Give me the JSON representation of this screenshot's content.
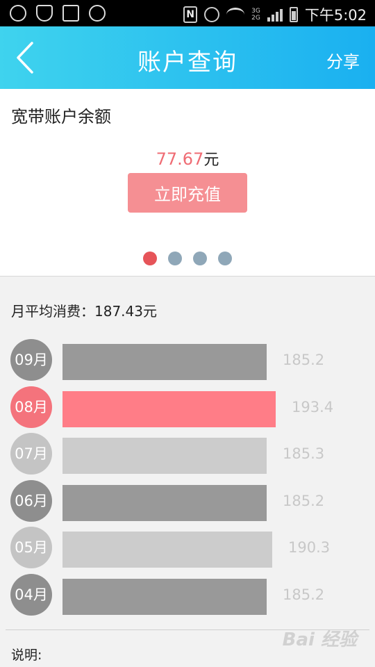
{
  "statusbar": {
    "time": "下午5:02",
    "net_top": "3G",
    "net_bottom": "2G",
    "nfc": "N"
  },
  "header": {
    "title": "账户查询",
    "share_label": "分享"
  },
  "balance": {
    "title": "宽带账户余额",
    "amount": "77.67",
    "unit": "元",
    "recharge_label": "立即充值",
    "pager": {
      "count": 4,
      "active": 0
    }
  },
  "consumption": {
    "average_label": "月平均消费：187.43元",
    "months": [
      {
        "month": "09月",
        "value": 185.2,
        "value_text": "185.2",
        "bar_color": "#999999",
        "badge_color": "#8e8e8e"
      },
      {
        "month": "08月",
        "value": 193.4,
        "value_text": "193.4",
        "bar_color": "#ff7d87",
        "badge_color": "#f4737c"
      },
      {
        "month": "07月",
        "value": 185.3,
        "value_text": "185.3",
        "bar_color": "#cccccc",
        "badge_color": "#c4c4c4"
      },
      {
        "month": "06月",
        "value": 185.2,
        "value_text": "185.2",
        "bar_color": "#999999",
        "badge_color": "#8e8e8e"
      },
      {
        "month": "05月",
        "value": 190.3,
        "value_text": "190.3",
        "bar_color": "#cccccc",
        "badge_color": "#c4c4c4"
      },
      {
        "month": "04月",
        "value": 185.2,
        "value_text": "185.2",
        "bar_color": "#999999",
        "badge_color": "#8e8e8e"
      }
    ]
  },
  "note_label": "说明:",
  "watermark": "Bai 经验",
  "colors": {
    "header_start": "#3fd3ee",
    "header_end": "#1ab0f0",
    "accent": "#ef6c74",
    "button": "#f58f93"
  }
}
